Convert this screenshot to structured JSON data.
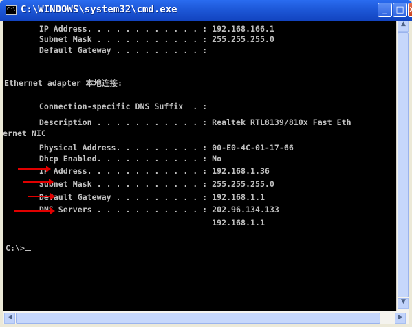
{
  "window": {
    "title": "C:\\WINDOWS\\system32\\cmd.exe",
    "controls": {
      "minimize": "_",
      "maximize": "□",
      "close": "×"
    }
  },
  "console": {
    "lines": [
      "       IP Address. . . . . . . . . . . . : 192.168.166.1",
      "       Subnet Mask . . . . . . . . . . . : 255.255.255.0",
      "       Default Gateway . . . . . . . . . :",
      "",
      "Ethernet adapter 本地连接:",
      "",
      "       Connection-specific DNS Suffix  . :",
      "       Description . . . . . . . . . . . : Realtek RTL8139/810x Fast Eth",
      "ernet NIC",
      "       Physical Address. . . . . . . . . : 00-E0-4C-01-17-66",
      "       Dhcp Enabled. . . . . . . . . . . : No",
      "       IP Address. . . . . . . . . . . . : 192.168.1.36",
      "       Subnet Mask . . . . . . . . . . . : 255.255.255.0",
      "       Default Gateway . . . . . . . . . : 192.168.1.1",
      "       DNS Servers . . . . . . . . . . . : 202.96.134.133",
      "                                           192.168.1.1",
      "",
      "C:\\>"
    ]
  },
  "annotations": {
    "arrow_color": "#e00000",
    "highlighted_fields": [
      "IP Address",
      "Subnet Mask",
      "Default Gateway",
      "DNS Servers"
    ]
  },
  "colors": {
    "console_bg": "#000000",
    "console_text": "#c0c0c0",
    "titlebar": "#1d58d8"
  }
}
